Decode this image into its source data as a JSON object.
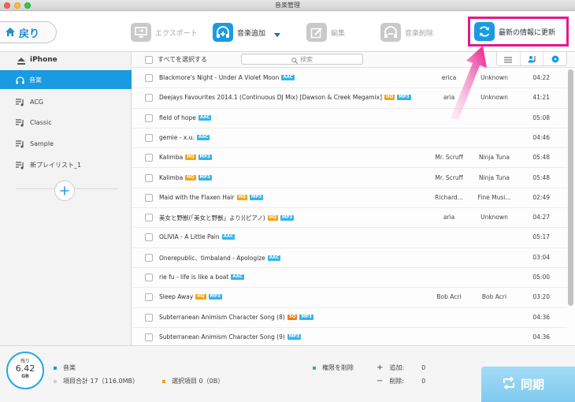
{
  "window": {
    "title": "音楽管理"
  },
  "toolbar": {
    "back_label": "戻り",
    "export_label": "エクスポート",
    "add_label": "音楽追加",
    "edit_label": "編集",
    "delete_label": "音楽削除",
    "refresh_label": "最新の情報に更新"
  },
  "sidebar": {
    "device": "iPhone",
    "items": [
      {
        "label": "音楽",
        "icon": "headphones-icon",
        "selected": true
      },
      {
        "label": "ACG",
        "icon": "playlist-icon"
      },
      {
        "label": "Classic",
        "icon": "playlist-icon"
      },
      {
        "label": "Sample",
        "icon": "playlist-icon"
      },
      {
        "label": "新プレイリスト_1",
        "icon": "playlist-icon"
      }
    ]
  },
  "list": {
    "select_all_label": "すべてを選択する",
    "search_placeholder": "検索",
    "rows": [
      {
        "title": "Blackmore's Night - Under A Violet Moon",
        "badges": [
          "AAC"
        ],
        "artist": "erica",
        "album": "Unknown",
        "time": "04:22"
      },
      {
        "title": "Deejays Favourites 2014.1 (Continuous DJ Mix) [Dawson & Creek Megamix]",
        "badges": [
          "HQ",
          "MP3"
        ],
        "artist": "aria",
        "album": "Unknown",
        "time": "41:21"
      },
      {
        "title": "field of hope",
        "badges": [
          "AAC"
        ],
        "artist": "",
        "album": "",
        "time": "05:08"
      },
      {
        "title": "gemie - x.u.",
        "badges": [
          "AAC"
        ],
        "artist": "",
        "album": "",
        "time": "04:46"
      },
      {
        "title": "Kalimba",
        "badges": [
          "HQ",
          "MP3"
        ],
        "artist": "Mr. Scruff",
        "album": "Ninja Tuna",
        "time": "05:48"
      },
      {
        "title": "Kalimba",
        "badges": [
          "HQ",
          "MP3"
        ],
        "artist": "Mr. Scruff",
        "album": "Ninja Tuna",
        "time": "05:48"
      },
      {
        "title": "Maid with the Flaxen Hair",
        "badges": [
          "HQ",
          "MP3"
        ],
        "artist": "Richard...",
        "album": "Fine Musi...",
        "time": "02:49"
      },
      {
        "title": "美女と野獣(「美女と野獣」より)(ピアノ)",
        "badges": [
          "HQ",
          "MP3"
        ],
        "artist": "aria",
        "album": "Unknown",
        "time": "04:27"
      },
      {
        "title": "OLIVIA - A Little Pain",
        "badges": [
          "AAC"
        ],
        "artist": "",
        "album": "",
        "time": "05:17"
      },
      {
        "title": "Onerepublic、timbaland - Apologize",
        "badges": [
          "AAC"
        ],
        "artist": "",
        "album": "",
        "time": "03:04"
      },
      {
        "title": "rie fu - life is like a boat",
        "badges": [
          "AAC"
        ],
        "artist": "",
        "album": "",
        "time": "05:00"
      },
      {
        "title": "Sleep Away",
        "badges": [
          "HQ",
          "MP3"
        ],
        "artist": "Bob Acri",
        "album": "Bob Acri",
        "time": "03:20"
      },
      {
        "title": "Subterranean Animism Character Song (8)",
        "badges": [
          "SQ",
          "MP3"
        ],
        "artist": "",
        "album": "",
        "time": "04:36"
      },
      {
        "title": "Subterranean Animism Character Song (9)",
        "badges": [
          "MP3"
        ],
        "artist": "",
        "album": "",
        "time": "04:36"
      }
    ]
  },
  "status": {
    "storage_caption": "残り",
    "storage_value": "6.42",
    "storage_unit": "GB",
    "music_label": "音楽",
    "total_label": "項目合計 17（116.0MB）",
    "selected_label": "選択項目 0（0B）",
    "remove_label": "権限を削除",
    "add_prefix": "追加:",
    "add_count": "0",
    "delete_prefix": "削除:",
    "delete_count": "0",
    "sync_label": "同期"
  },
  "colors": {
    "accent": "#1a9ae0",
    "highlight": "#e8168c",
    "hq_badge": "#f0a31a",
    "format_badge": "#37b4ea"
  }
}
